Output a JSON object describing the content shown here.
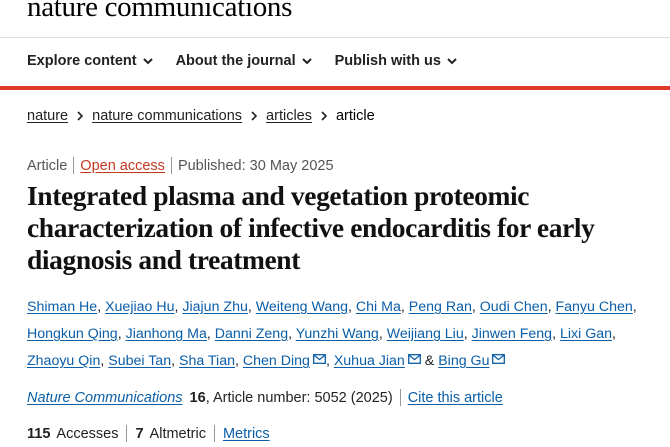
{
  "brand": "nature communications",
  "nav": [
    {
      "label": "Explore content"
    },
    {
      "label": "About the journal"
    },
    {
      "label": "Publish with us"
    }
  ],
  "breadcrumbs": [
    "nature",
    "nature communications",
    "articles",
    "article"
  ],
  "meta": {
    "type": "Article",
    "access": "Open access",
    "published": "Published: 30 May 2025"
  },
  "title": "Integrated plasma and vegetation proteomic characterization of infective endocarditis for early diagnosis and treatment",
  "authors": [
    "Shiman He",
    "Xuejiao Hu",
    "Jiajun Zhu",
    "Weiteng Wang",
    "Chi Ma",
    "Peng Ran",
    "Oudi Chen",
    "Fanyu Chen",
    "Hongkun Qing",
    "Jianhong Ma",
    "Danni Zeng",
    "Yunzhi Wang",
    "Weijiang Liu",
    "Jinwen Feng",
    "Lixi Gan",
    "Zhaoyu Qin",
    "Subei Tan",
    "Sha Tian",
    "Chen Ding",
    "Xuhua Jian",
    "Bing Gu"
  ],
  "author_conjunction": "&",
  "citation": {
    "journal": "Nature Communications",
    "volume": "16",
    "article_number": ", Article number: 5052 (2025)",
    "cite_label": "Cite this article"
  },
  "metrics": {
    "accesses_count": "115",
    "accesses_label": "Accesses",
    "altmetric_count": "7",
    "altmetric_label": "Altmetric",
    "metrics_link": "Metrics"
  },
  "colors": {
    "accent_red": "#e0382a",
    "link_blue": "#0b5ea8",
    "open_access": "#c4381f"
  }
}
